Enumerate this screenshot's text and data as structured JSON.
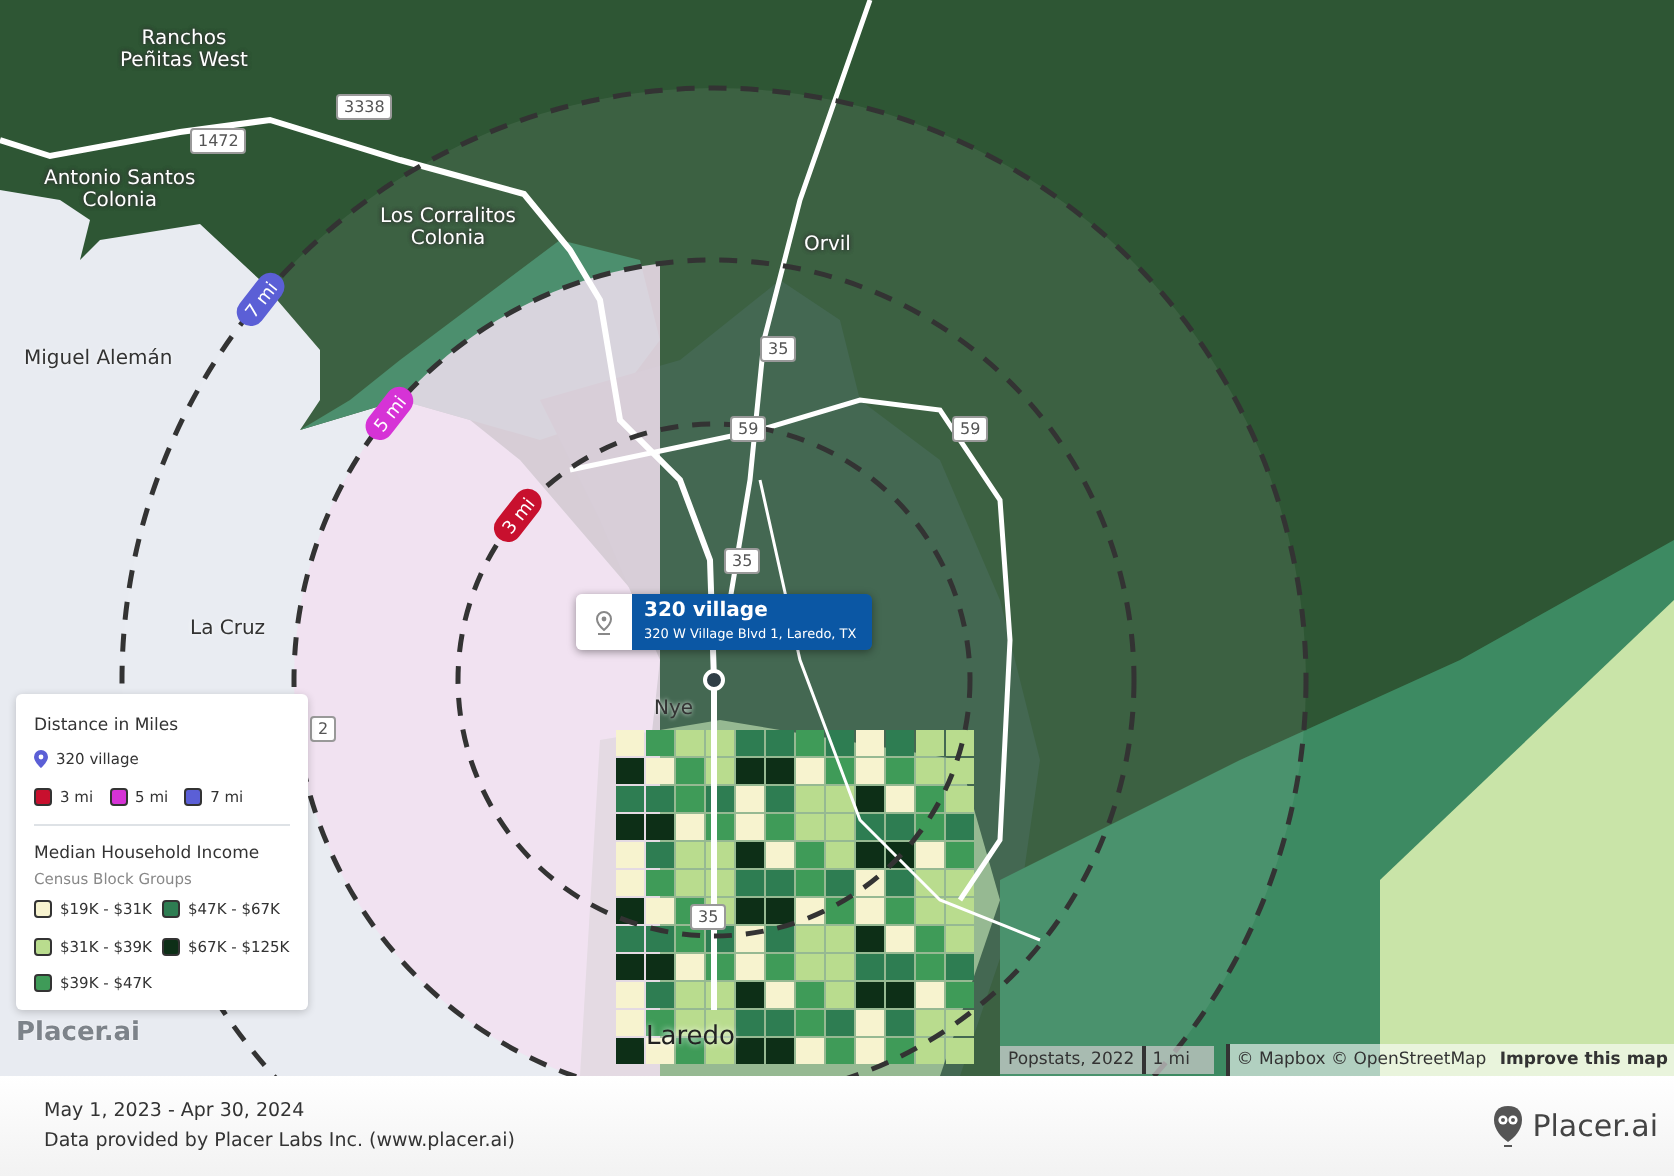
{
  "map": {
    "place_labels": [
      "Ranchos\nPeñitas West",
      "Antonio Santos\nColonia",
      "Los Corralitos\nColonia",
      "Orvil",
      "Miguel Alemán",
      "La Cruz",
      "Nye",
      "Laredo"
    ],
    "road_shields": [
      "3338",
      "1472",
      "35",
      "59",
      "59",
      "35",
      "35",
      "2"
    ],
    "rings": [
      {
        "label": "3 mi",
        "color": "#c8102e"
      },
      {
        "label": "5 mi",
        "color": "#d633d6"
      },
      {
        "label": "7 mi",
        "color": "#5b5fd6"
      }
    ],
    "popup": {
      "title": "320 village",
      "address": "320 W Village Blvd 1, Laredo, TX"
    },
    "watermark": "Placer.ai",
    "attribution": {
      "source": "Popstats, 2022",
      "scale": "1 mi",
      "credits": "© Mapbox © OpenStreetMap",
      "improve_link": "Improve this map"
    }
  },
  "legend": {
    "title": "Distance in Miles",
    "location": "320 village",
    "rings": [
      {
        "label": "3 mi",
        "color": "#c8102e"
      },
      {
        "label": "5 mi",
        "color": "#d633d6"
      },
      {
        "label": "7 mi",
        "color": "#5b5fd6"
      }
    ],
    "income_title": "Median Household Income",
    "income_subtitle": "Census Block Groups",
    "buckets": [
      {
        "label": "$19K - $31K",
        "color": "#f7f3cf"
      },
      {
        "label": "$47K - $67K",
        "color": "#2e7d52"
      },
      {
        "label": "$31K - $39K",
        "color": "#b9dc8e"
      },
      {
        "label": "$67K - $125K",
        "color": "#0d2f17"
      },
      {
        "label": "$39K - $47K",
        "color": "#3f9b58"
      }
    ]
  },
  "footer": {
    "date_range": "May 1, 2023 - Apr 30, 2024",
    "provider": "Data provided by Placer Labs Inc. (www.placer.ai)",
    "logo_text": "Placer.ai"
  }
}
